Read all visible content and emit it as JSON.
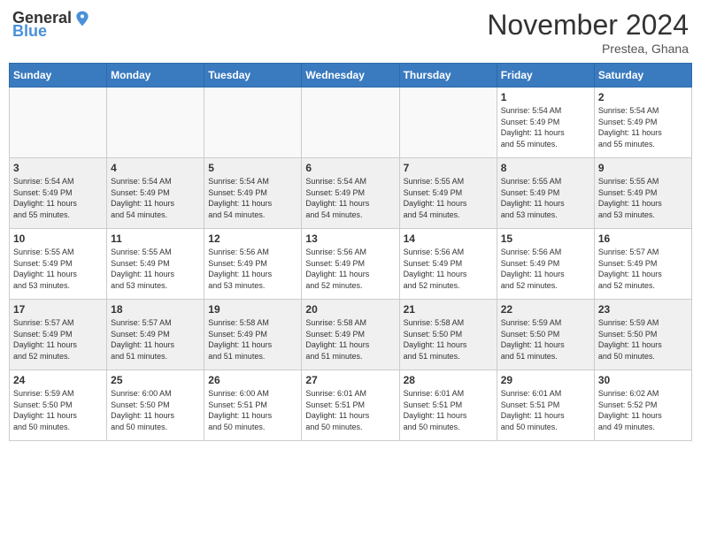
{
  "header": {
    "logo_general": "General",
    "logo_blue": "Blue",
    "month_title": "November 2024",
    "location": "Prestea, Ghana"
  },
  "weekdays": [
    "Sunday",
    "Monday",
    "Tuesday",
    "Wednesday",
    "Thursday",
    "Friday",
    "Saturday"
  ],
  "weeks": [
    [
      {
        "day": "",
        "info": ""
      },
      {
        "day": "",
        "info": ""
      },
      {
        "day": "",
        "info": ""
      },
      {
        "day": "",
        "info": ""
      },
      {
        "day": "",
        "info": ""
      },
      {
        "day": "1",
        "info": "Sunrise: 5:54 AM\nSunset: 5:49 PM\nDaylight: 11 hours\nand 55 minutes."
      },
      {
        "day": "2",
        "info": "Sunrise: 5:54 AM\nSunset: 5:49 PM\nDaylight: 11 hours\nand 55 minutes."
      }
    ],
    [
      {
        "day": "3",
        "info": "Sunrise: 5:54 AM\nSunset: 5:49 PM\nDaylight: 11 hours\nand 55 minutes."
      },
      {
        "day": "4",
        "info": "Sunrise: 5:54 AM\nSunset: 5:49 PM\nDaylight: 11 hours\nand 54 minutes."
      },
      {
        "day": "5",
        "info": "Sunrise: 5:54 AM\nSunset: 5:49 PM\nDaylight: 11 hours\nand 54 minutes."
      },
      {
        "day": "6",
        "info": "Sunrise: 5:54 AM\nSunset: 5:49 PM\nDaylight: 11 hours\nand 54 minutes."
      },
      {
        "day": "7",
        "info": "Sunrise: 5:55 AM\nSunset: 5:49 PM\nDaylight: 11 hours\nand 54 minutes."
      },
      {
        "day": "8",
        "info": "Sunrise: 5:55 AM\nSunset: 5:49 PM\nDaylight: 11 hours\nand 53 minutes."
      },
      {
        "day": "9",
        "info": "Sunrise: 5:55 AM\nSunset: 5:49 PM\nDaylight: 11 hours\nand 53 minutes."
      }
    ],
    [
      {
        "day": "10",
        "info": "Sunrise: 5:55 AM\nSunset: 5:49 PM\nDaylight: 11 hours\nand 53 minutes."
      },
      {
        "day": "11",
        "info": "Sunrise: 5:55 AM\nSunset: 5:49 PM\nDaylight: 11 hours\nand 53 minutes."
      },
      {
        "day": "12",
        "info": "Sunrise: 5:56 AM\nSunset: 5:49 PM\nDaylight: 11 hours\nand 53 minutes."
      },
      {
        "day": "13",
        "info": "Sunrise: 5:56 AM\nSunset: 5:49 PM\nDaylight: 11 hours\nand 52 minutes."
      },
      {
        "day": "14",
        "info": "Sunrise: 5:56 AM\nSunset: 5:49 PM\nDaylight: 11 hours\nand 52 minutes."
      },
      {
        "day": "15",
        "info": "Sunrise: 5:56 AM\nSunset: 5:49 PM\nDaylight: 11 hours\nand 52 minutes."
      },
      {
        "day": "16",
        "info": "Sunrise: 5:57 AM\nSunset: 5:49 PM\nDaylight: 11 hours\nand 52 minutes."
      }
    ],
    [
      {
        "day": "17",
        "info": "Sunrise: 5:57 AM\nSunset: 5:49 PM\nDaylight: 11 hours\nand 52 minutes."
      },
      {
        "day": "18",
        "info": "Sunrise: 5:57 AM\nSunset: 5:49 PM\nDaylight: 11 hours\nand 51 minutes."
      },
      {
        "day": "19",
        "info": "Sunrise: 5:58 AM\nSunset: 5:49 PM\nDaylight: 11 hours\nand 51 minutes."
      },
      {
        "day": "20",
        "info": "Sunrise: 5:58 AM\nSunset: 5:49 PM\nDaylight: 11 hours\nand 51 minutes."
      },
      {
        "day": "21",
        "info": "Sunrise: 5:58 AM\nSunset: 5:50 PM\nDaylight: 11 hours\nand 51 minutes."
      },
      {
        "day": "22",
        "info": "Sunrise: 5:59 AM\nSunset: 5:50 PM\nDaylight: 11 hours\nand 51 minutes."
      },
      {
        "day": "23",
        "info": "Sunrise: 5:59 AM\nSunset: 5:50 PM\nDaylight: 11 hours\nand 50 minutes."
      }
    ],
    [
      {
        "day": "24",
        "info": "Sunrise: 5:59 AM\nSunset: 5:50 PM\nDaylight: 11 hours\nand 50 minutes."
      },
      {
        "day": "25",
        "info": "Sunrise: 6:00 AM\nSunset: 5:50 PM\nDaylight: 11 hours\nand 50 minutes."
      },
      {
        "day": "26",
        "info": "Sunrise: 6:00 AM\nSunset: 5:51 PM\nDaylight: 11 hours\nand 50 minutes."
      },
      {
        "day": "27",
        "info": "Sunrise: 6:01 AM\nSunset: 5:51 PM\nDaylight: 11 hours\nand 50 minutes."
      },
      {
        "day": "28",
        "info": "Sunrise: 6:01 AM\nSunset: 5:51 PM\nDaylight: 11 hours\nand 50 minutes."
      },
      {
        "day": "29",
        "info": "Sunrise: 6:01 AM\nSunset: 5:51 PM\nDaylight: 11 hours\nand 50 minutes."
      },
      {
        "day": "30",
        "info": "Sunrise: 6:02 AM\nSunset: 5:52 PM\nDaylight: 11 hours\nand 49 minutes."
      }
    ]
  ]
}
